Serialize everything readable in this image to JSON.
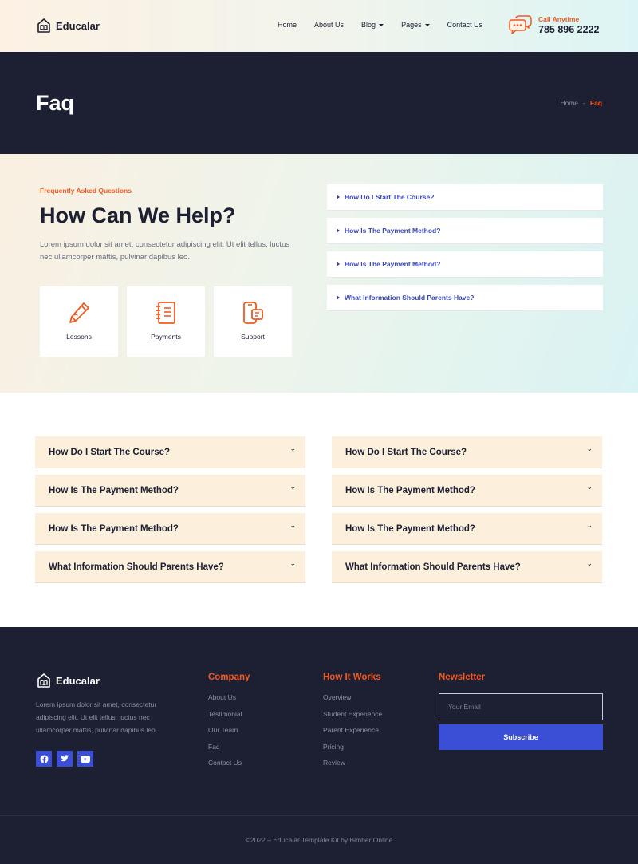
{
  "brand": {
    "name": "Educalar",
    "accent": "#f05a22",
    "dark": "#1d2033",
    "blue": "#3b4fd6"
  },
  "nav": {
    "items": [
      {
        "label": "Home",
        "dropdown": false
      },
      {
        "label": "About Us",
        "dropdown": false
      },
      {
        "label": "Blog",
        "dropdown": true
      },
      {
        "label": "Pages",
        "dropdown": true
      },
      {
        "label": "Contact Us",
        "dropdown": false
      }
    ]
  },
  "call": {
    "label": "Call Anytime",
    "phone": "785 896 2222",
    "icon": "chat-bubble-icon"
  },
  "banner": {
    "title": "Faq",
    "breadcrumb": {
      "home": "Home",
      "sep": "-",
      "current": "Faq"
    }
  },
  "help": {
    "eyebrow": "Frequently Asked Questions",
    "title": "How Can We Help?",
    "description": "Lorem ipsum dolor sit amet, consectetur adipiscing elit. Ut elit tellus, luctus nec ullamcorper mattis, pulvinar dapibus leo.",
    "cards": [
      {
        "label": "Lessons",
        "icon": "pencil-icon"
      },
      {
        "label": "Payments",
        "icon": "notebook-icon"
      },
      {
        "label": "Support",
        "icon": "mobile-support-icon"
      }
    ],
    "side_accordion": [
      "How Do I Start The Course?",
      "How Is The Payment Method?",
      "How Is The Payment Method?",
      "What Information Should Parents Have?"
    ]
  },
  "faq": {
    "left": [
      "How Do I Start The Course?",
      "How Is The Payment Method?",
      "How Is The Payment Method?",
      "What Information Should Parents Have?"
    ],
    "right": [
      "How Do I Start The Course?",
      "How Is The Payment Method?",
      "How Is The Payment Method?",
      "What Information Should Parents Have?"
    ]
  },
  "footer": {
    "description": "Lorem ipsum dolor sit amet, consectetur adipiscing elit. Ut elit tellus, luctus nec ullamcorper mattis, pulvinar dapibus leo.",
    "socials": [
      "facebook-icon",
      "twitter-icon",
      "youtube-icon"
    ],
    "company": {
      "title": "Company",
      "links": [
        "About Us",
        "Testimonial",
        "Our Team",
        "Faq",
        "Contact Us"
      ]
    },
    "how": {
      "title": "How It Works",
      "links": [
        "Overview",
        "Student Experience",
        "Parent Experience",
        "Pricing",
        "Review"
      ]
    },
    "newsletter": {
      "title": "Newsletter",
      "placeholder": "Your Email",
      "button": "Subscribe"
    },
    "copyright": "©2022 – Educalar Template Kit by Bimber Online"
  }
}
